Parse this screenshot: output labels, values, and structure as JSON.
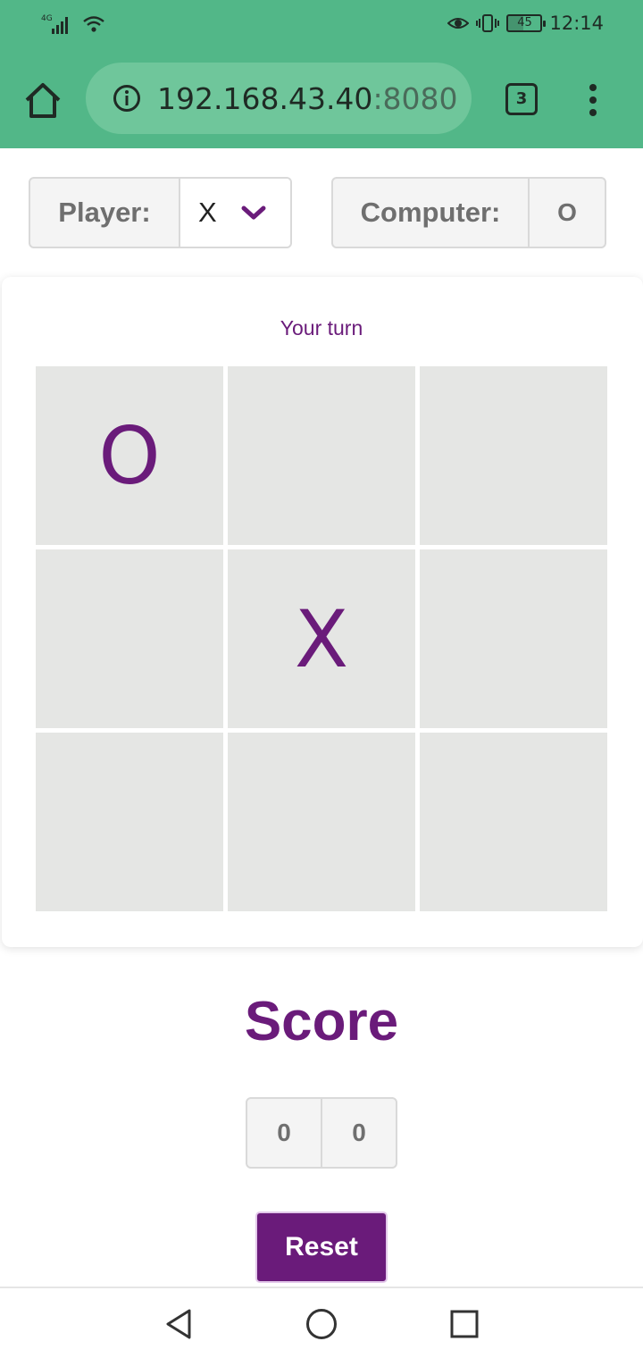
{
  "status_bar": {
    "network_label": "4G",
    "battery_level": "45",
    "battery_fraction": 0.45,
    "time": "12:14",
    "icons": [
      "signal-icon",
      "wifi-icon",
      "eye-icon",
      "vibrate-icon",
      "battery-icon"
    ]
  },
  "browser": {
    "url_host": "192.168.43.40",
    "url_port": ":8080",
    "tab_count": "3",
    "icons": [
      "home-icon",
      "info-icon",
      "tabs-icon",
      "more-vert-icon"
    ]
  },
  "selectors": {
    "player_label": "Player:",
    "player_value": "X",
    "computer_label": "Computer:",
    "computer_value": "O"
  },
  "game": {
    "turn_text": "Your turn",
    "cells": [
      "O",
      "",
      "",
      "",
      "X",
      "",
      "",
      "",
      ""
    ]
  },
  "score": {
    "title": "Score",
    "player": "0",
    "computer": "0"
  },
  "reset_label": "Reset",
  "colors": {
    "chrome_green": "#52b788",
    "accent_purple": "#6a1b7a",
    "cell_bg": "#e5e6e4"
  },
  "nav_icons": [
    "back-icon",
    "home-circle-icon",
    "recents-icon"
  ]
}
